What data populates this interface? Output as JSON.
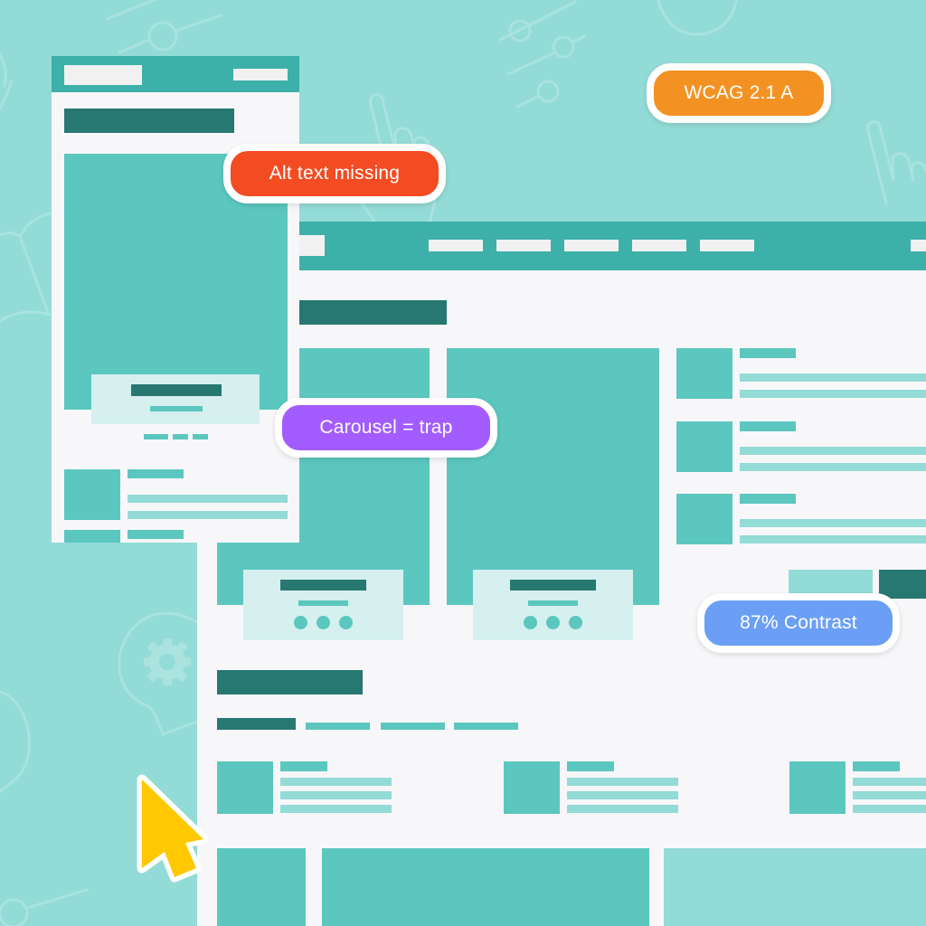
{
  "background": {
    "color": "#93dbd6",
    "decorative_icons": [
      "slider-icon",
      "pointer-hand-icon",
      "lightbulb-gear-icon",
      "book-icon",
      "circle-icon"
    ]
  },
  "palette": {
    "nav": "#3db0a9",
    "heading": "#287872",
    "block": "#5bc7bf",
    "line": "#93dbd6",
    "card": "#d5f0ef",
    "page": "#f7f7fa"
  },
  "badges": [
    {
      "id": "wcag",
      "label": "WCAG 2.1 A",
      "color": "#f39223"
    },
    {
      "id": "alt-text",
      "label": "Alt text missing",
      "color": "#f34b22"
    },
    {
      "id": "carousel",
      "label": "Carousel = trap",
      "color": "#a25cff"
    },
    {
      "id": "contrast",
      "label": "87% Contrast",
      "color": "#6b9ff5"
    }
  ],
  "cursor": {
    "icon": "arrow-cursor-icon",
    "color": "#ffc800"
  },
  "mobile_mockup": {
    "nav_items": 1,
    "carousel_dots": 3,
    "list_items": 2
  },
  "desktop_mockup": {
    "nav_items": 5,
    "carousel_slides": 2,
    "carousel_dots_per_slide": 3,
    "sidebar_list_items": 3,
    "filter_tabs": 4,
    "grid_cards": 3,
    "bottom_tiles": 3
  }
}
